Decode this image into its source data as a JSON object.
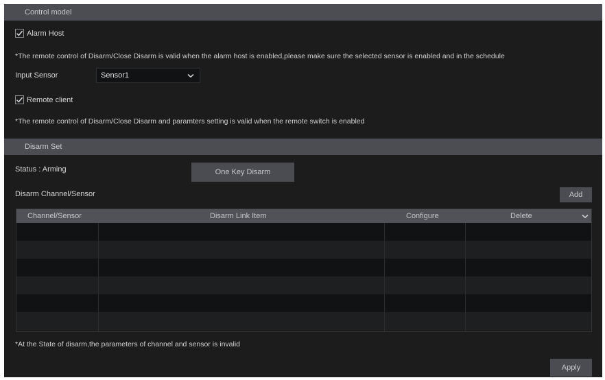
{
  "control_mode": {
    "section_title": "Control model",
    "alarm_host": {
      "label": "Alarm Host",
      "checked": true
    },
    "alarm_host_note": "*The remote control of Disarm/Close Disarm is valid when the alarm host is enabled,please make sure the selected sensor is enabled and in the schedule",
    "input_sensor": {
      "label": "Input Sensor",
      "value": "Sensor1"
    },
    "remote_client": {
      "label": "Remote client",
      "checked": true
    },
    "remote_client_note": "*The remote control of Disarm/Close Disarm and paramters setting is valid when the remote switch is enabled"
  },
  "disarm_set": {
    "section_title": "Disarm Set",
    "status": "Status : Arming",
    "one_key_disarm_label": "One Key Disarm",
    "channel_sensor_label": "Disarm Channel/Sensor",
    "add_label": "Add",
    "table": {
      "columns": [
        "Channel/Sensor",
        "Disarm Link Item",
        "Configure",
        "Delete"
      ],
      "rows": [
        [
          "",
          "",
          "",
          ""
        ],
        [
          "",
          "",
          "",
          ""
        ],
        [
          "",
          "",
          "",
          ""
        ],
        [
          "",
          "",
          "",
          ""
        ],
        [
          "",
          "",
          "",
          ""
        ],
        [
          "",
          "",
          "",
          ""
        ]
      ]
    },
    "footer_note": "*At the State of disarm,the parameters of channel and sensor is invalid",
    "apply_label": "Apply"
  },
  "colors": {
    "background": "#1c1c1c",
    "section_bar": "#4b4d52",
    "button": "#4a4c51",
    "check": "#cfd3d8"
  },
  "icons": {
    "checkbox": "check-icon",
    "dropdown": "chevron-down-icon"
  }
}
